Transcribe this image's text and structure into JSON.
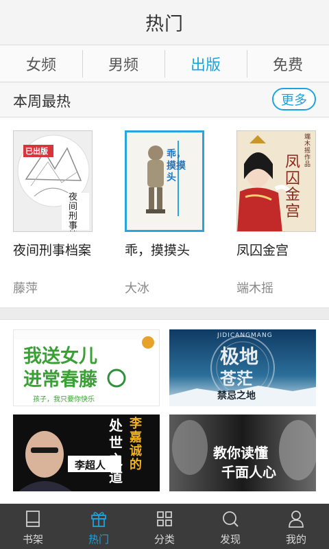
{
  "header": {
    "title": "热门"
  },
  "tabs": [
    {
      "label": "女频",
      "active": false
    },
    {
      "label": "男频",
      "active": false
    },
    {
      "label": "出版",
      "active": true
    },
    {
      "label": "免费",
      "active": false
    }
  ],
  "weekly": {
    "title": "本周最热",
    "more_label": "更多",
    "books": [
      {
        "name": "夜间刑事档案",
        "author": "藤萍",
        "cover_badge": "已出版",
        "cover_title": "夜间刑事档案"
      },
      {
        "name": "乖，摸摸头",
        "author": "大冰",
        "cover_title": "乖，摸摸头"
      },
      {
        "name": "凤囚金宫",
        "author": "端木摇",
        "cover_title": "凤囚金宫",
        "cover_sub": "端木摇 作品"
      }
    ]
  },
  "banners": [
    {
      "line1": "我送女儿",
      "line2": "进常春藤",
      "tagline": "孩子，我只要你快乐"
    },
    {
      "latin": "JIDICANGMANG",
      "line1": "极地",
      "line2": "苍茫",
      "line3": "禁忌之地"
    },
    {
      "line1": "李嘉诚的",
      "line2": "处世之道",
      "author": "李超人"
    },
    {
      "line1": "教你读懂",
      "line2": "千面人心"
    }
  ],
  "bottom_nav": [
    {
      "label": "书架",
      "icon": "bookshelf-icon",
      "active": false
    },
    {
      "label": "热门",
      "icon": "gift-icon",
      "active": true
    },
    {
      "label": "分类",
      "icon": "grid-icon",
      "active": false
    },
    {
      "label": "发现",
      "icon": "search-icon",
      "active": false
    },
    {
      "label": "我的",
      "icon": "user-icon",
      "active": false
    }
  ],
  "colors": {
    "accent": "#1ba3e0",
    "nav_bg": "#3b3b3b"
  }
}
